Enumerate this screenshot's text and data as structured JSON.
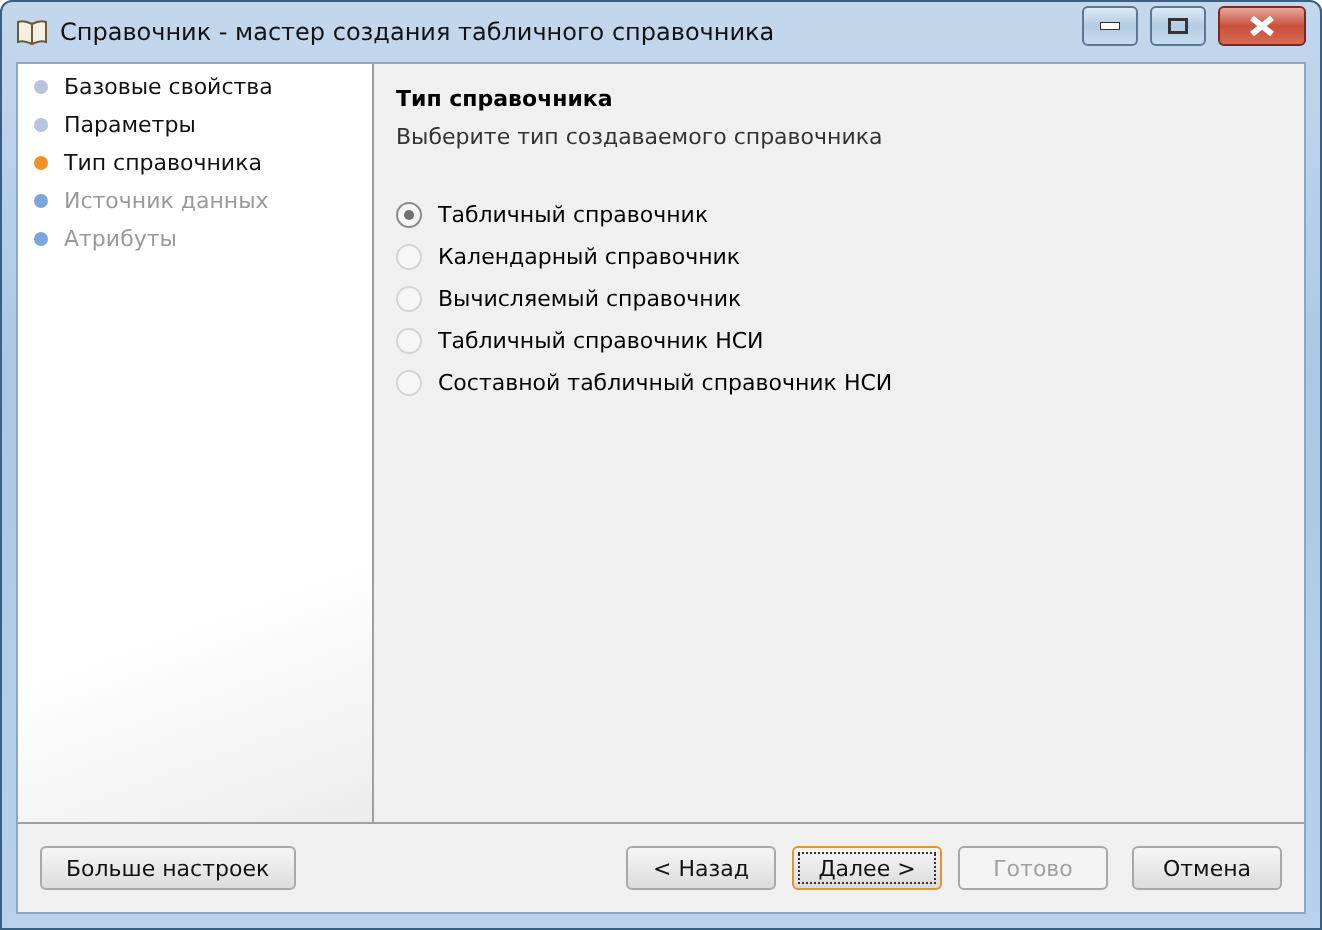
{
  "window": {
    "title": "Справочник - мастер создания табличного справочника"
  },
  "steps": [
    {
      "label": "Базовые свойства",
      "current": false,
      "disabled": false
    },
    {
      "label": "Параметры",
      "current": false,
      "disabled": false
    },
    {
      "label": "Тип справочника",
      "current": true,
      "disabled": false
    },
    {
      "label": "Источник данных",
      "current": false,
      "disabled": true
    },
    {
      "label": "Атрибуты",
      "current": false,
      "disabled": true
    }
  ],
  "page": {
    "heading": "Тип справочника",
    "description": "Выберите тип создаваемого справочника"
  },
  "options": [
    {
      "label": "Табличный справочник",
      "selected": true
    },
    {
      "label": "Календарный справочник",
      "selected": false
    },
    {
      "label": "Вычисляемый справочник",
      "selected": false
    },
    {
      "label": "Табличный справочник НСИ",
      "selected": false
    },
    {
      "label": "Составной табличный справочник НСИ",
      "selected": false
    }
  ],
  "more_button": {
    "label": "Больше настроек"
  },
  "nav_buttons": [
    {
      "label": "< Назад",
      "disabled": false,
      "default": false
    },
    {
      "label": "Далее >",
      "disabled": false,
      "default": true
    },
    {
      "label": "Готово",
      "disabled": true,
      "default": false
    },
    {
      "label": "Отмена",
      "disabled": false,
      "default": false
    }
  ]
}
